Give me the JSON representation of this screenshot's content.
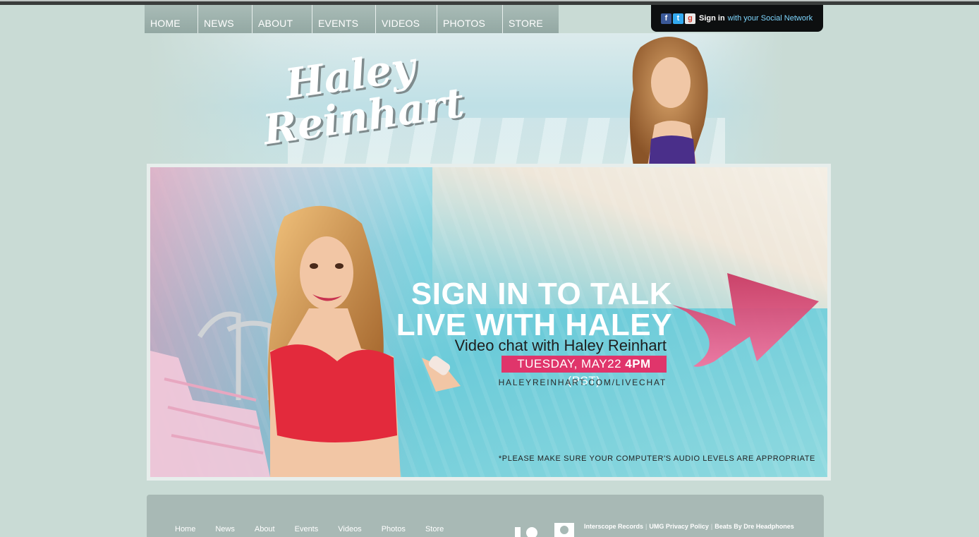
{
  "nav": {
    "items": [
      "HOME",
      "NEWS",
      "ABOUT",
      "EVENTS",
      "VIDEOS",
      "PHOTOS",
      "STORE"
    ]
  },
  "signin": {
    "icons": [
      "facebook-icon",
      "twitter-icon",
      "google-icon"
    ],
    "strong": "Sign in",
    "rest": "with your Social Network"
  },
  "header": {
    "logo_line1": "Haley",
    "logo_line2": "Reinhart"
  },
  "banner": {
    "headline_line1": "SIGN IN TO TALK",
    "headline_line2": "LIVE WITH HALEY",
    "subline": "Video chat with Haley Reinhart",
    "date_prefix": "TUESDAY, MAY22",
    "date_time": "4PM",
    "date_suffix": "(PST)",
    "url": "HALEYREINHART.COM/LIVECHAT",
    "disclaimer": "*PLEASE MAKE SURE YOUR COMPUTER'S AUDIO LEVELS ARE APPROPRIATE",
    "accent_color": "#e0356b"
  },
  "footer": {
    "nav": [
      "Home",
      "News",
      "About",
      "Events",
      "Videos",
      "Photos",
      "Store"
    ],
    "links": [
      "Interscope Records",
      "UMG Privacy Policy",
      "Beats By Dre Headphones"
    ]
  },
  "colors": {
    "page_bg": "#c9dbd5",
    "nav_bg": "#9fb3ae",
    "signin_bg": "#0d0f10",
    "signin_link": "#7fd7ff"
  }
}
